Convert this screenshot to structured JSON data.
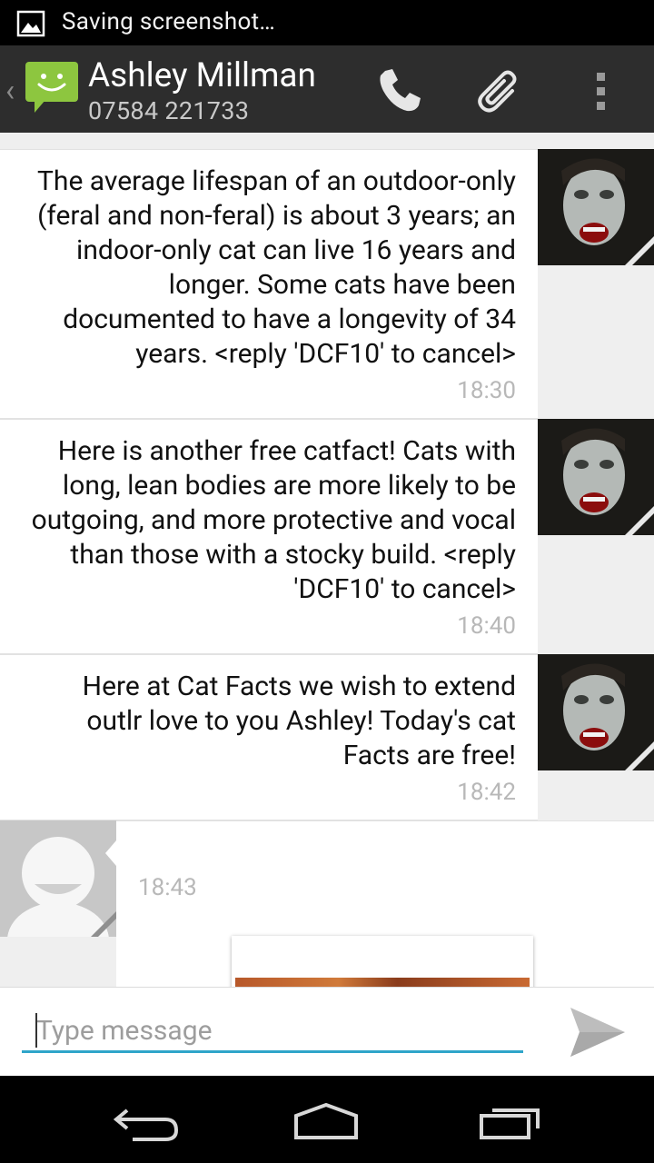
{
  "status_bar": {
    "notification_text": "Saving screenshot…",
    "icon": "image-icon"
  },
  "action_bar": {
    "contact_name": "Ashley Millman",
    "contact_number": "07584 221733",
    "icons": [
      "chevron-left-icon",
      "messaging-app-icon",
      "phone-icon",
      "paperclip-icon",
      "overflow-menu-icon"
    ]
  },
  "messages": [
    {
      "direction": "incoming",
      "text": "The average lifespan of an outdoor-only (feral and non-feral) is about 3 years; an indoor-only cat can live 16 years and longer. Some cats have been documented to have a longevity of 34 years. <reply 'DCF10' to cancel>",
      "time": "18:30"
    },
    {
      "direction": "incoming",
      "text": "Here is another free catfact! Cats with long, lean bodies are more likely to be outgoing, and more protective and vocal than those with a stocky build. <reply 'DCF10' to cancel>",
      "time": "18:40"
    },
    {
      "direction": "incoming",
      "text": "Here at Cat Facts we wish to extend outlr love to you Ashley! Today's cat Facts are free!",
      "time": "18:42"
    },
    {
      "direction": "outgoing",
      "text": "",
      "time": "18:43",
      "attachment": "image"
    }
  ],
  "compose": {
    "placeholder": "Type message",
    "value": ""
  },
  "colors": {
    "action_bar": "#2d2d2d",
    "accent": "#2fa5c9",
    "app_icon": "#8dc63f"
  }
}
